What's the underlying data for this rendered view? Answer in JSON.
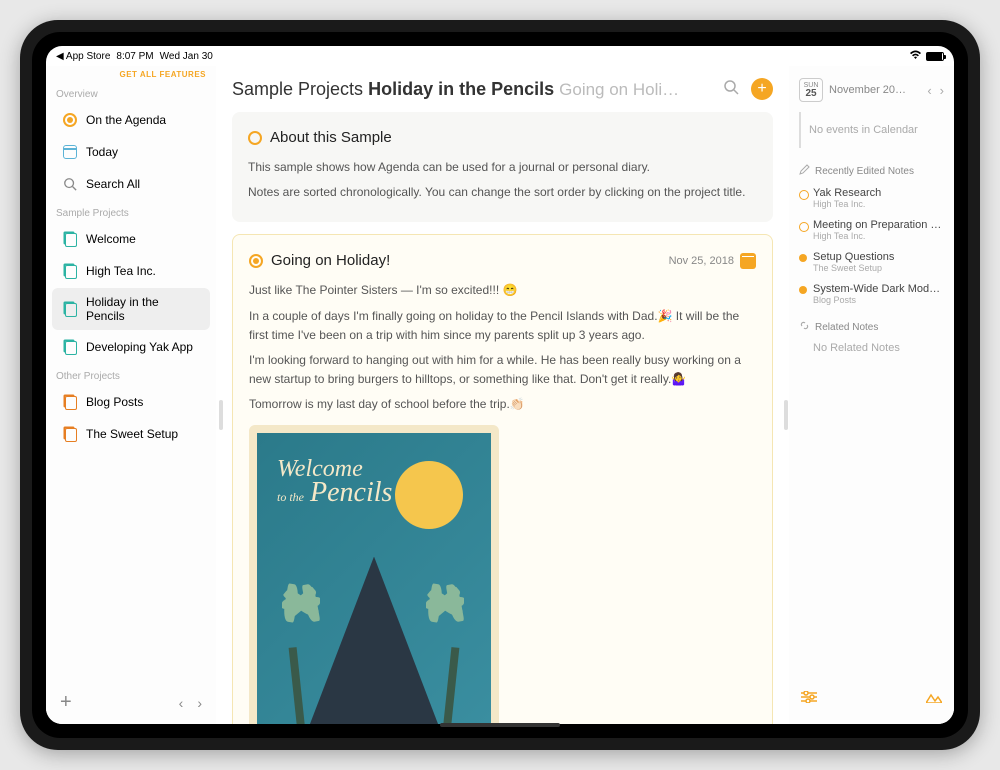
{
  "status_bar": {
    "back_app": "◀ App Store",
    "time": "8:07 PM",
    "date": "Wed Jan 30"
  },
  "sidebar": {
    "get_features": "GET ALL FEATURES",
    "sections": {
      "overview": "Overview",
      "sample_projects": "Sample Projects",
      "other_projects": "Other Projects"
    },
    "overview_items": [
      "On the Agenda",
      "Today",
      "Search All"
    ],
    "sample_projects_items": [
      "Welcome",
      "High Tea Inc.",
      "Holiday in the Pencils",
      "Developing Yak App"
    ],
    "other_projects_items": [
      "Blog Posts",
      "The Sweet Setup"
    ]
  },
  "main": {
    "breadcrumb_parent": "Sample Projects",
    "breadcrumb_title": "Holiday in the Pencils",
    "breadcrumb_next": "Going on Holi…",
    "notes": {
      "about": {
        "title": "About this Sample",
        "p1": "This sample shows how Agenda can be used for a journal or personal diary.",
        "p2": "Notes are sorted chronologically. You can change the sort order by clicking on the project title."
      },
      "holiday": {
        "title": "Going on Holiday!",
        "date": "Nov 25, 2018",
        "p1": "Just like The Pointer Sisters — I'm so excited!!! 😁",
        "p2": "In a couple of days I'm finally going on holiday to the Pencil Islands with Dad.🎉 It will be the first time I've been on a trip with him since my parents split up 3 years ago.",
        "p3": "I'm looking forward to hanging out with him for a while. He has been really busy working on a new startup to bring burgers to hilltops, or something like that. Don't get it really.🤷‍♀️",
        "p4": "Tomorrow is my last day of school before the trip.👏🏻",
        "postcard": {
          "line1": "Welcome",
          "line2": "to the",
          "line3": "Pencils"
        }
      }
    }
  },
  "right_panel": {
    "cal": {
      "dow": "SUN",
      "day": "25"
    },
    "month_label": "November 20…",
    "no_events": "No events in Calendar",
    "recent_title": "Recently Edited Notes",
    "recent": [
      {
        "title": "Yak Research",
        "sub": "High Tea Inc."
      },
      {
        "title": "Meeting on Preparation f…",
        "sub": "High Tea Inc."
      },
      {
        "title": "Setup Questions",
        "sub": "The Sweet Setup"
      },
      {
        "title": "System-Wide Dark Mode…",
        "sub": "Blog Posts"
      }
    ],
    "related_title": "Related Notes",
    "no_related": "No Related Notes"
  }
}
